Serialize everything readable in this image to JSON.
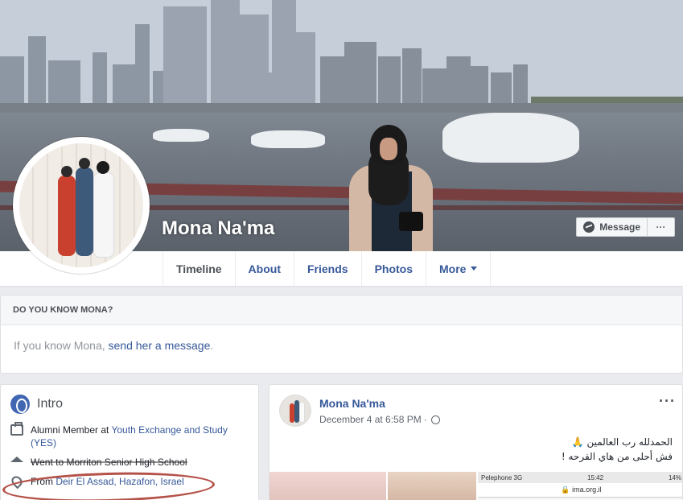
{
  "profile": {
    "name": "Mona Na'ma"
  },
  "cover_actions": {
    "message_label": "Message",
    "more_label": "···"
  },
  "tabs": [
    {
      "label": "Timeline",
      "active": true
    },
    {
      "label": "About",
      "active": false
    },
    {
      "label": "Friends",
      "active": false
    },
    {
      "label": "Photos",
      "active": false
    },
    {
      "label": "More",
      "active": false
    }
  ],
  "know_card": {
    "heading": "DO YOU KNOW MONA?",
    "prefix": "If you know Mona, ",
    "link": "send her a message",
    "suffix": "."
  },
  "intro": {
    "title": "Intro",
    "rows": [
      {
        "icon": "briefcase-icon",
        "prefix": "Alumni Member at ",
        "link": "Youth Exchange and Study (YES)"
      },
      {
        "icon": "graduation-cap-icon",
        "prefix": "Went to Morriton Senior High School",
        "link": ""
      },
      {
        "icon": "location-pin-icon",
        "prefix": "From ",
        "link": "Deir El Assad, Hazafon, Israel"
      }
    ]
  },
  "post": {
    "author": "Mona Na'ma",
    "timestamp": "December 4 at 6:58 PM · ",
    "menu": "···",
    "text_line1": "الحمدلله رب العالمين 🙏",
    "text_line2": "فش أحلى من هاي الفرحه !",
    "phone_carrier": "Pelephone  3G",
    "phone_time": "15:42",
    "phone_battery": "14%",
    "phone_url": "🔒 ima.org.il"
  },
  "colors": {
    "link": "#365899",
    "annotation_ellipse": "#b5524a",
    "background": "#e9ebee"
  }
}
